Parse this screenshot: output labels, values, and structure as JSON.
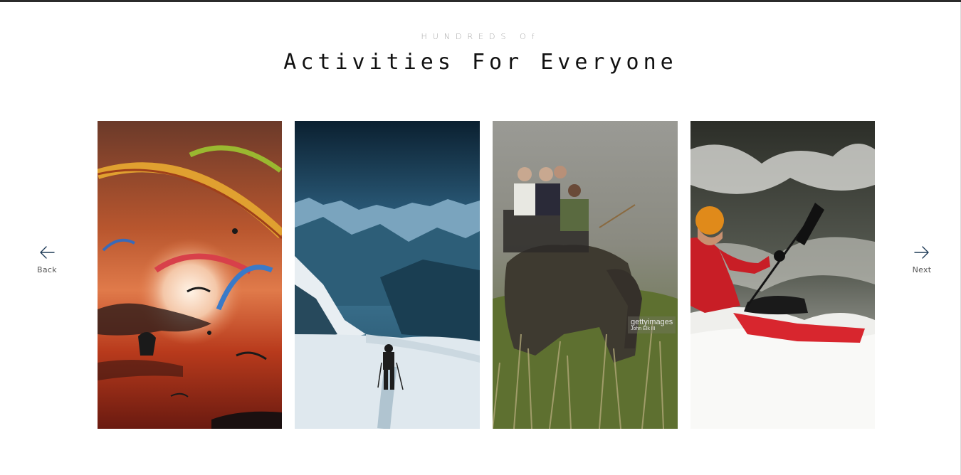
{
  "header": {
    "eyebrow": "HUNDREDS Of",
    "title": "Activities For Everyone"
  },
  "nav": {
    "back_label": "Back",
    "next_label": "Next",
    "arrow_color": "#1f3b57"
  },
  "cards": [
    {
      "name": "paragliding",
      "icon": "paragliding-photo"
    },
    {
      "name": "mountain-hiking",
      "icon": "hiking-photo"
    },
    {
      "name": "elephant-safari",
      "icon": "safari-photo",
      "watermark": "gettyimages",
      "credit": "John Elk III"
    },
    {
      "name": "whitewater-kayaking",
      "icon": "kayaking-photo"
    }
  ]
}
